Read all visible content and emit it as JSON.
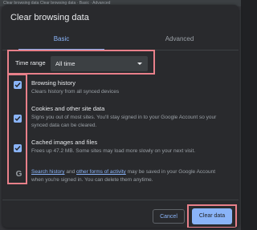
{
  "background_text": "Clear browsing data Clear browsing data · Basic · Advanced",
  "dialog": {
    "title": "Clear browsing data",
    "tabs": [
      {
        "label": "Basic",
        "active": true
      },
      {
        "label": "Advanced",
        "active": false
      }
    ],
    "time_range": {
      "label": "Time range",
      "value": "All time"
    },
    "items": [
      {
        "title": "Browsing history",
        "description": "Clears history from all synced devices",
        "checked": true
      },
      {
        "title": "Cookies and other site data",
        "description": "Signs you out of most sites. You'll stay signed in to your Google Account so your synced data can be cleared.",
        "checked": true
      },
      {
        "title": "Cached images and files",
        "description": "Frees up 47.2 MB. Some sites may load more slowly on your next visit.",
        "checked": true
      }
    ],
    "info": {
      "link1": "Search history",
      "mid": " and ",
      "link2": "other forms of activity",
      "rest": " may be saved in your Google Account when you're signed in. You can delete them anytime."
    },
    "buttons": {
      "cancel": "Cancel",
      "clear": "Clear data"
    }
  },
  "colors": {
    "accent": "#8ab4f8",
    "annotation": "#e8808a",
    "dialog_bg": "#292a2d"
  }
}
